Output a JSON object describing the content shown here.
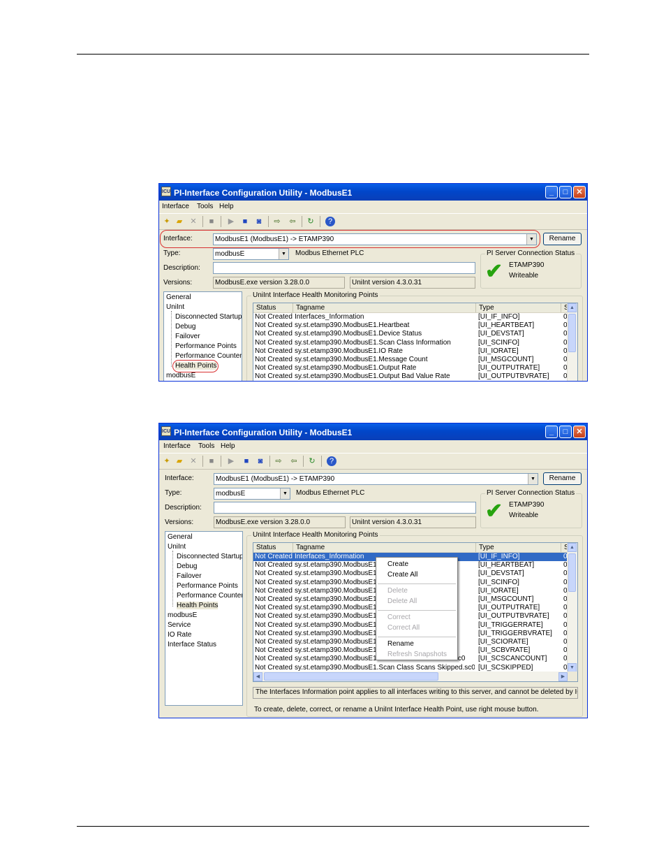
{
  "windows": [
    {
      "title": "PI-Interface Configuration Utility - ModbusE1",
      "app_icon": "ICU",
      "menu": [
        "Interface",
        "Tools",
        "Help"
      ],
      "toolbar_icons": [
        "new-icon",
        "open-icon",
        "delete-icon",
        "save-icon",
        "play-icon",
        "stop-icon",
        "restart-icon",
        "export-icon",
        "import-icon",
        "refresh-icon",
        "help-icon"
      ],
      "interface_label": "Interface:",
      "interface_value": "ModbusE1 (ModbusE1) -> ETAMP390",
      "rename_label": "Rename",
      "type_label": "Type:",
      "type_value": "modbusE",
      "type_desc": "Modbus Ethernet PLC",
      "description_label": "Description:",
      "description_value": "",
      "versions_label": "Versions:",
      "version_exe": "ModbusE.exe version 3.28.0.0",
      "version_uniint": "UniInt version 4.3.0.31",
      "server_status_title": "PI Server Connection Status",
      "server_name": "ETAMP390",
      "server_state": "Writeable",
      "tree": {
        "top": [
          "General",
          "UniInt"
        ],
        "children": [
          "Disconnected Startup",
          "Debug",
          "Failover",
          "Performance Points",
          "Performance Counters",
          "Health Points"
        ],
        "bottom": [
          "modbusE"
        ]
      },
      "group_title": "UniInt Interface Health Monitoring Points",
      "columns": [
        "Status",
        "Tagname",
        "Type",
        "S"
      ],
      "rows": [
        [
          "Not Created",
          "Interfaces_Information",
          "[UI_IF_INFO]",
          "0"
        ],
        [
          "Not Created",
          "sy.st.etamp390.ModbusE1.Heartbeat",
          "[UI_HEARTBEAT]",
          "0"
        ],
        [
          "Not Created",
          "sy.st.etamp390.ModbusE1.Device Status",
          "[UI_DEVSTAT]",
          "0"
        ],
        [
          "Not Created",
          "sy.st.etamp390.ModbusE1.Scan Class Information",
          "[UI_SCINFO]",
          "0"
        ],
        [
          "Not Created",
          "sy.st.etamp390.ModbusE1.IO Rate",
          "[UI_IORATE]",
          "0"
        ],
        [
          "Not Created",
          "sy.st.etamp390.ModbusE1.Message Count",
          "[UI_MSGCOUNT]",
          "0"
        ],
        [
          "Not Created",
          "sy.st.etamp390.ModbusE1.Output Rate",
          "[UI_OUTPUTRATE]",
          "0"
        ],
        [
          "Not Created",
          "sy.st.etamp390.ModbusE1.Output Bad Value Rate",
          "[UI_OUTPUTBVRATE]",
          "0"
        ]
      ]
    },
    {
      "title": "PI-Interface Configuration Utility - ModbusE1",
      "app_icon": "ICU",
      "menu": [
        "Interface",
        "Tools",
        "Help"
      ],
      "interface_label": "Interface:",
      "interface_value": "ModbusE1 (ModbusE1) -> ETAMP390",
      "rename_label": "Rename",
      "type_label": "Type:",
      "type_value": "modbusE",
      "type_desc": "Modbus Ethernet PLC",
      "description_label": "Description:",
      "description_value": "",
      "versions_label": "Versions:",
      "version_exe": "ModbusE.exe version 3.28.0.0",
      "version_uniint": "UniInt version 4.3.0.31",
      "server_status_title": "PI Server Connection Status",
      "server_name": "ETAMP390",
      "server_state": "Writeable",
      "tree": {
        "top": [
          "General",
          "UniInt"
        ],
        "children": [
          "Disconnected Startup",
          "Debug",
          "Failover",
          "Performance Points",
          "Performance Counters",
          "Health Points"
        ],
        "bottom": [
          "modbusE",
          "Service",
          "IO Rate",
          "Interface Status"
        ]
      },
      "group_title": "UniInt Interface Health Monitoring Points",
      "columns": [
        "Status",
        "Tagname",
        "Type",
        "S"
      ],
      "rows": [
        [
          "Not Created",
          "Interfaces_Information",
          "[UI_IF_INFO]",
          "0"
        ],
        [
          "Not Created",
          "sy.st.etamp390.ModbusE1.He",
          "[UI_HEARTBEAT]",
          "0"
        ],
        [
          "Not Created",
          "sy.st.etamp390.ModbusE1.De",
          "[UI_DEVSTAT]",
          "0"
        ],
        [
          "Not Created",
          "sy.st.etamp390.ModbusE1.Sc",
          "[UI_SCINFO]",
          "0"
        ],
        [
          "Not Created",
          "sy.st.etamp390.ModbusE1.IO",
          "[UI_IORATE]",
          "0"
        ],
        [
          "Not Created",
          "sy.st.etamp390.ModbusE1.Me",
          "[UI_MSGCOUNT]",
          "0"
        ],
        [
          "Not Created",
          "sy.st.etamp390.ModbusE1.Ou",
          "[UI_OUTPUTRATE]",
          "0"
        ],
        [
          "Not Created",
          "sy.st.etamp390.ModbusE1.Ou",
          "[UI_OUTPUTBVRATE]",
          "0"
        ],
        [
          "Not Created",
          "sy.st.etamp390.ModbusE1.Tri",
          "[UI_TRIGGERRATE]",
          "0"
        ],
        [
          "Not Created",
          "sy.st.etamp390.ModbusE1.Tri",
          "[UI_TRIGGERBVRATE]",
          "0"
        ],
        [
          "Not Created",
          "sy.st.etamp390.ModbusE1.Sc",
          "[UI_SCIORATE]",
          "0"
        ],
        [
          "Not Created",
          "sy.st.etamp390.ModbusE1.Sc",
          "[UI_SCBVRATE]",
          "0"
        ],
        [
          "Not Created",
          "sy.st.etamp390.ModbusE1.Scan Class Scan Count.sc0",
          "[UI_SCSCANCOUNT]",
          "0"
        ],
        [
          "Not Created",
          "sy.st.etamp390.ModbusE1.Scan Class Scans Skipped.sc0",
          "[UI_SCSKIPPED]",
          "0"
        ]
      ],
      "context_menu": [
        {
          "label": "Create",
          "enabled": true
        },
        {
          "label": "Create All",
          "enabled": true
        },
        {
          "separator": true
        },
        {
          "label": "Delete",
          "enabled": false
        },
        {
          "label": "Delete All",
          "enabled": false
        },
        {
          "separator": true
        },
        {
          "label": "Correct",
          "enabled": false
        },
        {
          "label": "Correct All",
          "enabled": false
        },
        {
          "separator": true
        },
        {
          "label": "Rename",
          "enabled": true
        },
        {
          "label": "Refresh Snapshots",
          "enabled": false
        }
      ],
      "info_message": "The Interfaces Information point applies to all interfaces writing to this server, and cannot be deleted by ICU",
      "hint_message": "To create, delete, correct, or rename a UniInt Interface Health Point, use right mouse button."
    }
  ]
}
